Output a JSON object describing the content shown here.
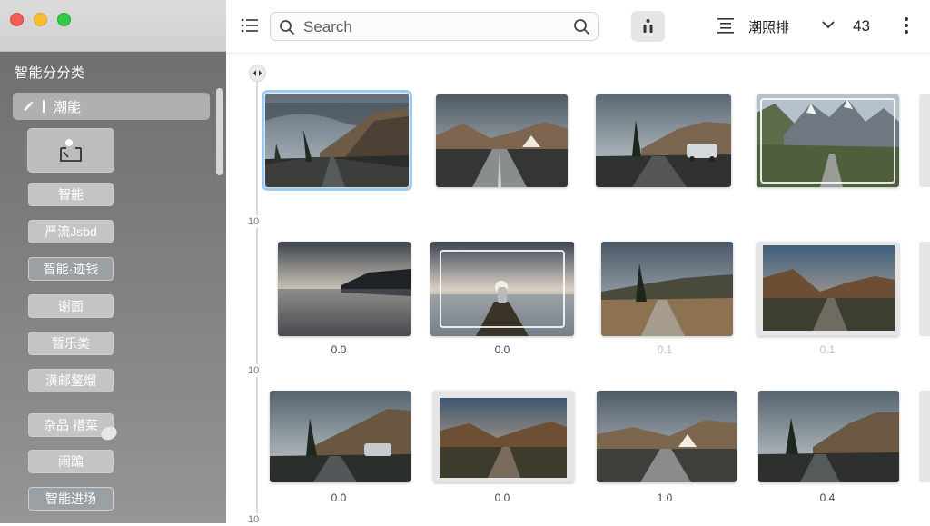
{
  "sidebar": {
    "heading": "智能分分类",
    "selected_item": "潮能",
    "items": [
      {
        "label": "智能"
      },
      {
        "label": "严流Jsbd"
      },
      {
        "label": "智能·迹钱"
      },
      {
        "label": "谢面"
      },
      {
        "label": "暂乐类"
      },
      {
        "label": "潢邮鳌熘"
      },
      {
        "label": "杂品 措菜"
      },
      {
        "label": "闹蹁"
      },
      {
        "label": "智能进场"
      }
    ]
  },
  "toolbar": {
    "search_placeholder": "Search",
    "sort_label": "潮照排",
    "photo_count": "43"
  },
  "timeline": {
    "marks": [
      "10",
      "10",
      "10"
    ]
  },
  "grid": {
    "rows": [
      {
        "captions": [
          "",
          "",
          "",
          ""
        ]
      },
      {
        "captions": [
          "0.0",
          "0.0",
          "0.1",
          "0.1"
        ]
      },
      {
        "captions": [
          "0.0",
          "0.0",
          "1.0",
          "0.4"
        ]
      }
    ]
  },
  "colors": {
    "selection_outline": "#9ecbf2",
    "traffic_red": "#f05f57",
    "traffic_yellow": "#f6bd2f",
    "traffic_green": "#35c94b"
  }
}
